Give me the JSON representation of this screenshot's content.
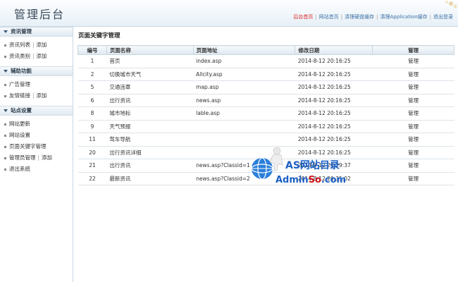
{
  "header": {
    "title": "管理后台",
    "nav": [
      {
        "label": "后台首页",
        "active": true
      },
      {
        "label": "网站首页"
      },
      {
        "label": "清理硬盘缓存"
      },
      {
        "label": "清理Application缓存"
      },
      {
        "label": "退出登录"
      }
    ]
  },
  "sidebar": {
    "sections": [
      {
        "title": "资讯管理",
        "items": [
          {
            "label": "资讯列表",
            "extra": "添加"
          },
          {
            "label": "资讯类别",
            "extra": "添加"
          }
        ]
      },
      {
        "title": "辅助功能",
        "items": [
          {
            "label": "广告管理"
          },
          {
            "label": "友情链接",
            "extra": "添加"
          }
        ]
      },
      {
        "title": "站点设置",
        "items": [
          {
            "label": "网站更新"
          },
          {
            "label": "网站设置"
          },
          {
            "label": "页面关键字管理"
          },
          {
            "label": "管理员管理",
            "extra": "添加"
          },
          {
            "label": "退出系统"
          }
        ]
      }
    ]
  },
  "main": {
    "title": "页面关键字管理",
    "columns": [
      "编号",
      "页面名称",
      "页面地址",
      "修改日期",
      "管理"
    ],
    "rows": [
      [
        "1",
        "首页",
        "index.asp",
        "2014-8-12 20:16:25",
        "管理"
      ],
      [
        "2",
        "切换城市天气",
        "Allcity.asp",
        "2014-8-12 20:16:25",
        "管理"
      ],
      [
        "5",
        "交通违章",
        "map.asp",
        "2014-8-12 20:16:25",
        "管理"
      ],
      [
        "6",
        "出行资讯",
        "news.asp",
        "2014-8-12 20:16:25",
        "管理"
      ],
      [
        "8",
        "城市地标",
        "lable.asp",
        "2014-8-12 20:16:25",
        "管理"
      ],
      [
        "9",
        "天气预报",
        "",
        "2014-8-12 20:16:25",
        "管理"
      ],
      [
        "11",
        "驾车导航",
        "",
        "2014-8-12 20:16:25",
        "管理"
      ],
      [
        "20",
        "出行资讯详细",
        "",
        "2014-8-12 20:16:25",
        "管理"
      ],
      [
        "21",
        "出行资讯",
        "news.asp?Classid=1",
        "2014-8-12 20:29:37",
        "管理"
      ],
      [
        "22",
        "最新资讯",
        "news.asp?Classid=2",
        "2014-8-12 20:35:02",
        "管理"
      ]
    ]
  },
  "watermark": {
    "line1": "AS网站目录",
    "line2_a": "Admin",
    "line2_b": "So",
    "line2_c": ".com"
  },
  "colors": {
    "accent_link": "#3b6fa3",
    "active_nav": "#dd2222",
    "watermark_blue": "#1b5fc5",
    "watermark_red": "#d1131b"
  }
}
